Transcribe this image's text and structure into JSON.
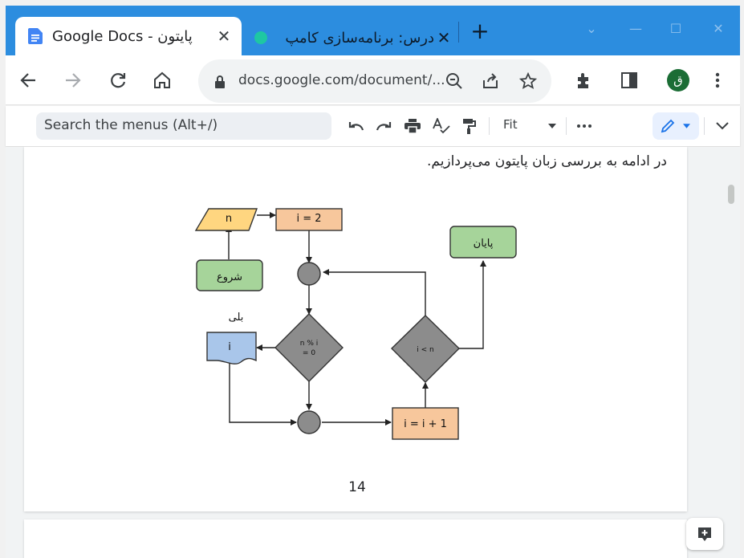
{
  "browser": {
    "active_tab": {
      "title": "Google Docs - پایتون"
    },
    "inactive_tab": {
      "title": "درس: برنامه‌سازی کامپ"
    },
    "url": "docs.google.com/document/...",
    "profile_initial": "ق"
  },
  "docs": {
    "search_menus_placeholder": "Search the menus (Alt+/)",
    "zoom": "Fit"
  },
  "document": {
    "paragraph": "در ادامه به بررسی زبان پایتون می‌پردازیم.",
    "page_number": "14",
    "flowchart": {
      "input_n": "n",
      "init_i": "i = 2",
      "start": "شروع",
      "end": "پایان",
      "cond_mod": "n % i",
      "cond_mod_2": "= 0",
      "cond_lt": "i < n",
      "yes_label": "بلی",
      "output_i": "i",
      "increment": "i = i + 1"
    }
  },
  "colors": {
    "tab_bar": "#2c8ddf",
    "start_end_fill": "#a6d49a",
    "input_fill": "#ffd680",
    "process_fill": "#f7c79c",
    "output_fill": "#a9c6ea",
    "decision_fill": "#8c8c8c"
  }
}
